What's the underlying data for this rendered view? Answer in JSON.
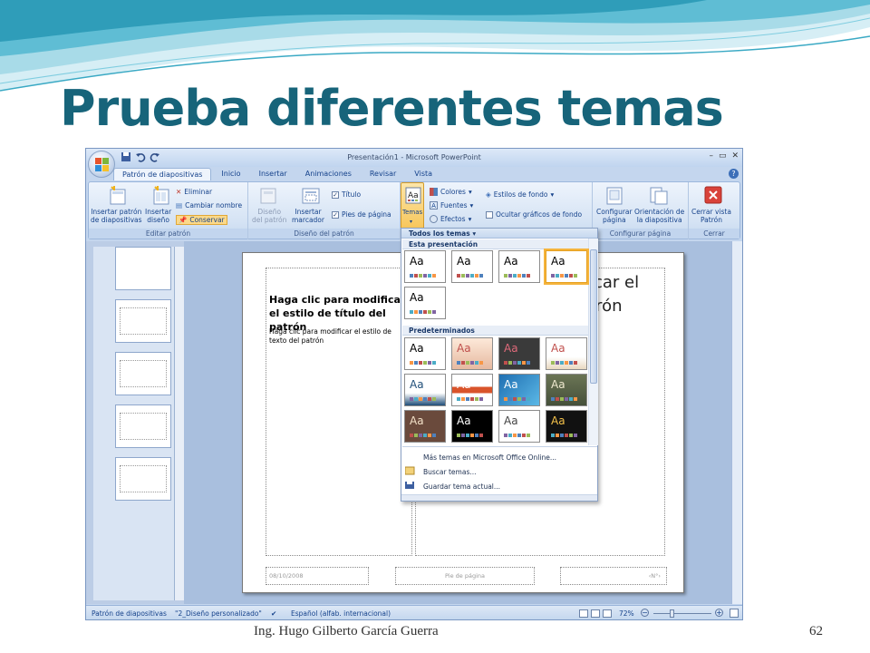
{
  "slide": {
    "title": "Prueba diferentes temas",
    "author": "Ing. Hugo Gilberto García Guerra",
    "page_number": "62"
  },
  "window": {
    "title": "Presentación1 - Microsoft PowerPoint",
    "controls": [
      "–",
      "▭",
      "✕"
    ]
  },
  "tabs": [
    {
      "label": "Patrón de diapositivas",
      "active": true
    },
    {
      "label": "Inicio"
    },
    {
      "label": "Insertar"
    },
    {
      "label": "Animaciones"
    },
    {
      "label": "Revisar"
    },
    {
      "label": "Vista"
    }
  ],
  "ribbon": {
    "editar_patron": {
      "label": "Editar patrón",
      "insert_master": "Insertar patrón\nde diapositivas",
      "insert_layout": "Insertar\ndiseño",
      "delete": "Eliminar",
      "rename": "Cambiar nombre",
      "preserve": "Conservar"
    },
    "diseno_patron": {
      "label": "Diseño del patrón",
      "master_layout": "Diseño\ndel patrón",
      "insert_placeholder": "Insertar\nmarcador",
      "title_check": "Título",
      "footers_check": "Pies de página"
    },
    "temas": {
      "themes_button": "Temas",
      "colors": "Colores",
      "fonts": "Fuentes",
      "effects": "Efectos",
      "bg_styles": "Estilos de fondo",
      "hide_bg": "Ocultar gráficos de fondo"
    },
    "configurar_pagina": {
      "label": "Configurar página",
      "page_setup": "Configurar\npágina",
      "orientation": "Orientación de\nla diapositiva"
    },
    "cerrar": {
      "label": "Cerrar",
      "close_view": "Cerrar vista\nPatrón"
    }
  },
  "gallery": {
    "header": "Todos los temas",
    "section_current": "Esta presentación",
    "section_builtin": "Predeterminados",
    "tile_text": "Aa",
    "commands": [
      "Más temas en Microsoft Office Online...",
      "Buscar temas...",
      "Guardar tema actual..."
    ]
  },
  "canvas": {
    "title_placeholder": "Haga clic para modificar el estilo de título del patrón",
    "body_placeholder": "Haga clic para modificar el estilo de texto del patrón",
    "right_title_partial_1": "icar el",
    "right_title_partial_2": "trón",
    "footer_date": "08/10/2008",
    "footer_center": "Pie de página",
    "footer_num": "‹N°›"
  },
  "statusbar": {
    "view": "Patrón de diapositivas",
    "theme": "\"2_Diseño personalizado\"",
    "language": "Español (alfab. internacional)",
    "zoom": "72%"
  }
}
